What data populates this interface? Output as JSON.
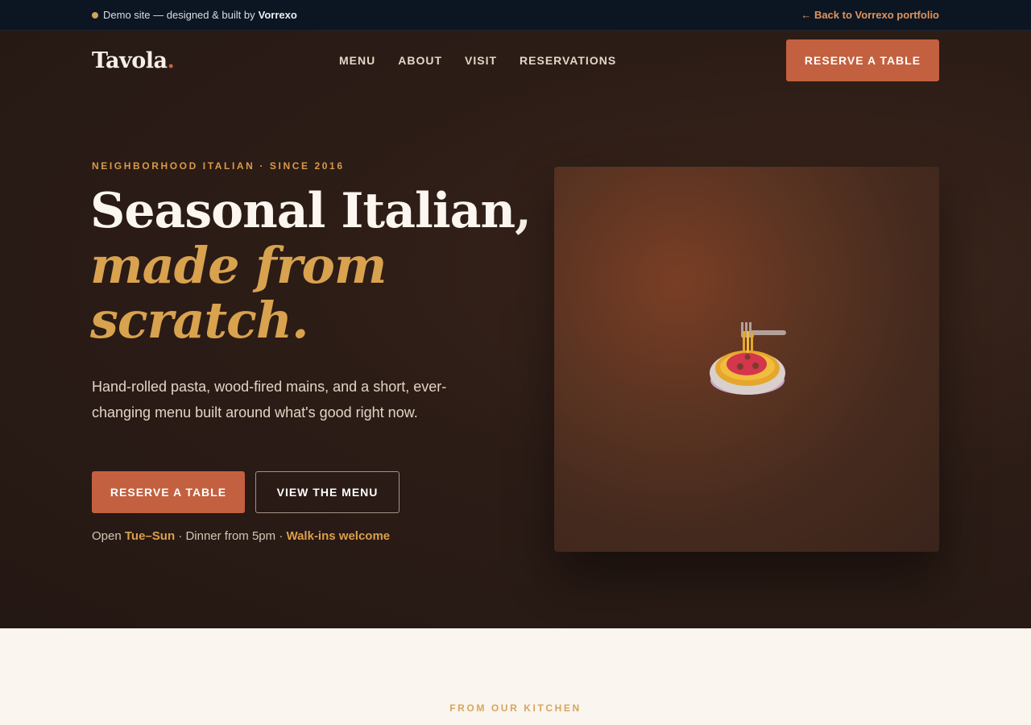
{
  "topbar": {
    "demo_text": "Demo site — designed & built by",
    "brand": "Vorrexo",
    "back_link": "← Back to Vorrexo portfolio"
  },
  "nav": {
    "logo": "Tavola",
    "logo_dot": ".",
    "links": [
      "MENU",
      "ABOUT",
      "VISIT",
      "RESERVATIONS"
    ],
    "cta": "RESERVE A TABLE"
  },
  "hero": {
    "eyebrow": "NEIGHBORHOOD ITALIAN · SINCE 2016",
    "headline_line1": "Seasonal Italian,",
    "headline_line2": "made from",
    "headline_line3": "scratch.",
    "subtext": "Hand-rolled pasta, wood-fired mains, and a short, ever-changing menu built around what's good right now.",
    "primary_button": "RESERVE A TABLE",
    "secondary_button": "VIEW THE MENU",
    "hours_prefix": "Open",
    "hours_days": "Tue–Sun",
    "hours_middle": "· Dinner from 5pm ·",
    "hours_walkins": "Walk-ins welcome",
    "image_icon": "spaghetti-icon"
  },
  "kitchen": {
    "label": "FROM OUR KITCHEN"
  },
  "colors": {
    "accent": "#c3603f",
    "gold": "#d9a24e",
    "topbar_bg": "#0c1622",
    "hero_bg": "#2c1c16",
    "cream": "#faf5ee"
  }
}
